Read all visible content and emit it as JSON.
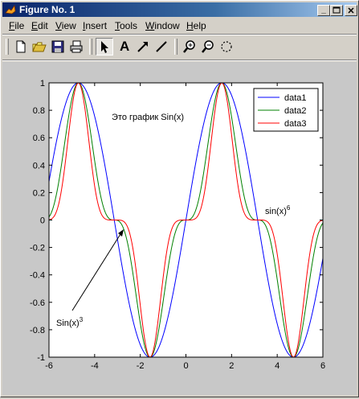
{
  "window": {
    "title": "Figure No. 1"
  },
  "menu": [
    {
      "pre": "",
      "u": "F",
      "post": "ile"
    },
    {
      "pre": "",
      "u": "E",
      "post": "dit"
    },
    {
      "pre": "",
      "u": "V",
      "post": "iew"
    },
    {
      "pre": "",
      "u": "I",
      "post": "nsert"
    },
    {
      "pre": "",
      "u": "T",
      "post": "ools"
    },
    {
      "pre": "",
      "u": "W",
      "post": "indow"
    },
    {
      "pre": "",
      "u": "H",
      "post": "elp"
    }
  ],
  "toolbar": {
    "tools": [
      "new-file-icon",
      "open-folder-icon",
      "save-icon",
      "print-icon",
      "select-arrow-icon",
      "insert-text-icon",
      "insert-arrow-icon",
      "insert-line-icon",
      "zoom-in-icon",
      "zoom-out-icon",
      "rotate-icon"
    ],
    "text_tool_label": "A"
  },
  "colors": {
    "data1": "#0000ff",
    "data2": "#008000",
    "data3": "#ff0000"
  },
  "chart_data": {
    "type": "line",
    "title": "",
    "xlabel": "",
    "ylabel": "",
    "xlim": [
      -6,
      6
    ],
    "ylim": [
      -1,
      1
    ],
    "xticks": [
      -6,
      -4,
      -2,
      0,
      2,
      4,
      6
    ],
    "yticks": [
      -1,
      -0.8,
      -0.6,
      -0.4,
      -0.2,
      0,
      0.2,
      0.4,
      0.6,
      0.8,
      1
    ],
    "ytick_labels": [
      "-1",
      "-0.8",
      "-0.6",
      "-0.4",
      "-0.2",
      "0",
      "0.2",
      "0.4",
      "0.6",
      "0.8",
      "1"
    ],
    "legend_position": "top-right",
    "grid": false,
    "series": [
      {
        "name": "data1",
        "function": "sin(x)",
        "power": 1,
        "color": "#0000ff"
      },
      {
        "name": "data2",
        "function": "sin(x)^3",
        "power": 3,
        "color": "#008000"
      },
      {
        "name": "data3",
        "function": "sin(x)^5",
        "power": 5,
        "color": "#ff0000"
      }
    ],
    "annotations": {
      "top_text": "Это график Sin(x)",
      "right_label_base": "sin(x)",
      "right_label_exp": "6",
      "left_label_base": "Sin(x)",
      "left_label_exp": "3"
    }
  }
}
